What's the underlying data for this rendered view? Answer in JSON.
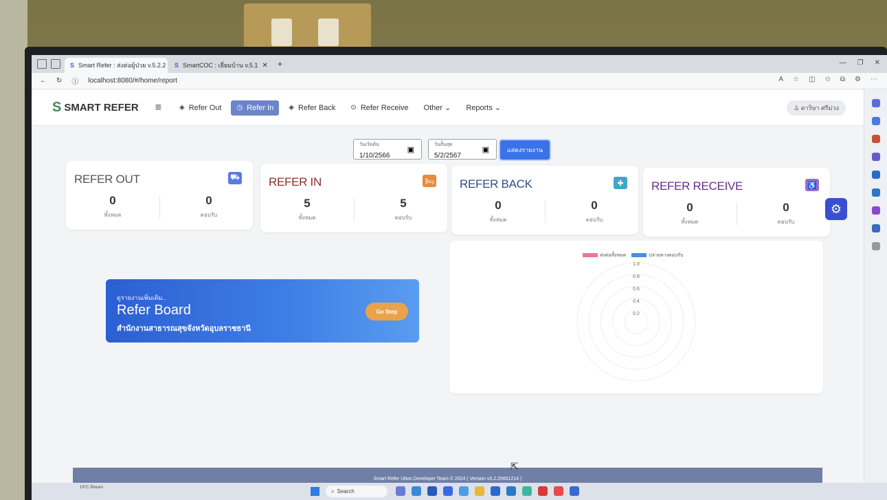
{
  "browser": {
    "tabs": [
      {
        "label": "Smart Refer : ส่งต่อผู้ป่วย v.5.2.2",
        "active": true
      },
      {
        "label": "SmartCOC : เยี่ยมบ้าน v.5.1",
        "active": false
      }
    ],
    "url": "localhost:8080/#/home/report"
  },
  "header": {
    "logo": "SMART REFER",
    "nav": [
      {
        "label": "Refer Out",
        "icon": "compass-icon"
      },
      {
        "label": "Refer In",
        "icon": "clock-icon",
        "active": true
      },
      {
        "label": "Refer Back",
        "icon": "compass-icon"
      },
      {
        "label": "Refer Receive",
        "icon": "circle-check-icon"
      },
      {
        "label": "Other ⌄"
      },
      {
        "label": "Reports ⌄"
      }
    ],
    "user": "ดาริษา ศรีม่วง"
  },
  "filters": {
    "start_label": "วันเริ่มต้น",
    "start_value": "1/10/2566",
    "end_label": "วันสิ้นสุด",
    "end_value": "5/2/2567",
    "submit_label": "แสดงรายงาน"
  },
  "cards": [
    {
      "title": "REFER OUT",
      "color": "#555555",
      "icon_color": "#5b7be0",
      "icon": "truck-icon",
      "total": "0",
      "total_label": "ทั้งหมด",
      "accepted": "0",
      "accepted_label": "ตอบรับ"
    },
    {
      "title": "REFER IN",
      "color": "#8b2c2c",
      "icon_color": "#e88a3c",
      "icon": "hospital-bed-icon",
      "total": "5",
      "total_label": "ทั้งหมด",
      "accepted": "5",
      "accepted_label": "ตอบรับ"
    },
    {
      "title": "REFER BACK",
      "color": "#2b4f8a",
      "icon_color": "#3fa8c8",
      "icon": "ambulance-icon",
      "total": "0",
      "total_label": "ทั้งหมด",
      "accepted": "0",
      "accepted_label": "ตอบรับ"
    },
    {
      "title": "REFER RECEIVE",
      "color": "#6a2c8a",
      "icon_color": "#a06ad0",
      "icon": "wheelchair-icon",
      "total": "0",
      "total_label": "ทั้งหมด",
      "accepted": "0",
      "accepted_label": "ตอบรับ"
    }
  ],
  "board": {
    "pre": "ดูรายงานเพิ่มเติม..",
    "title": "Refer Board",
    "subtitle": "สำนักงานสาธารณสุขจังหวัดอุบลราชธานี",
    "button": "Go Step"
  },
  "chart_data": {
    "type": "radar",
    "series": [
      {
        "name": "ส่งต่อทั้งหมด",
        "color": "#e87a8a",
        "values": []
      },
      {
        "name": "ปลายทางตอบรับ",
        "color": "#4a90d9",
        "values": []
      }
    ],
    "r_ticks": [
      "1.0",
      "0.8",
      "0.6",
      "0.4",
      "0.2"
    ],
    "rlim": [
      0,
      1
    ]
  },
  "footer": "Smart Refer Ubon Developer Team © 2024 ( Version v5.2.25661214 )",
  "taskbar": {
    "weather": "19°C\nมีหมอก",
    "search": "Search"
  }
}
